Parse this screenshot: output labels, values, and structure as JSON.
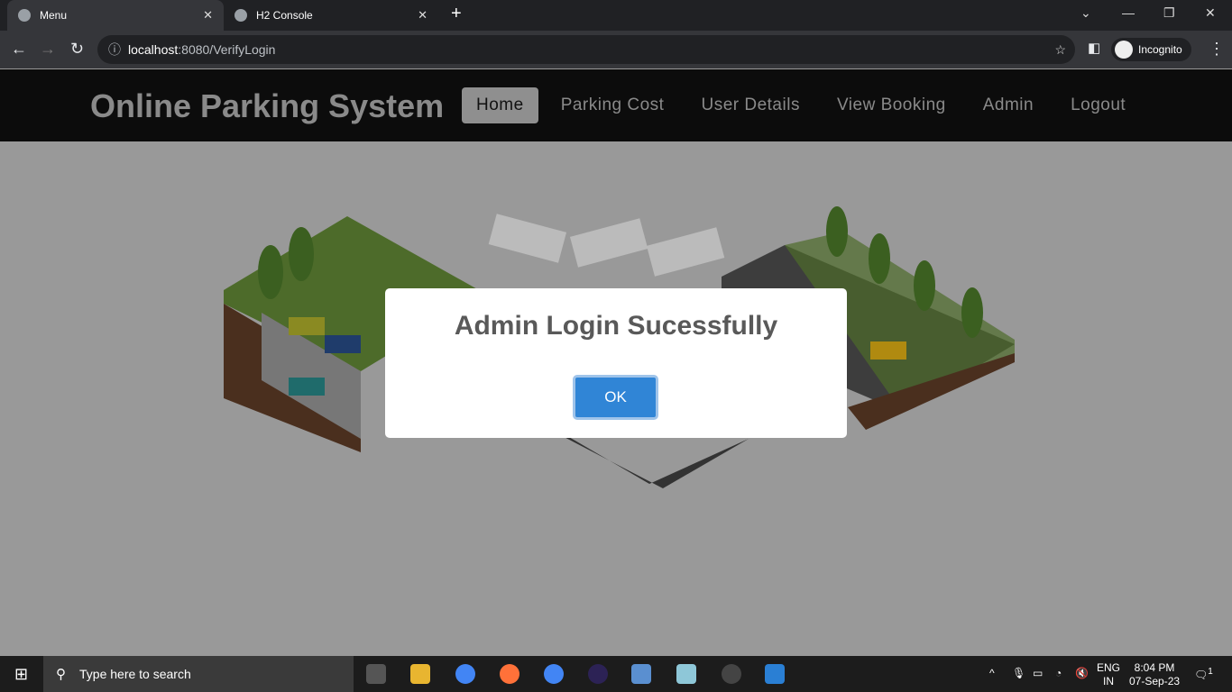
{
  "browser": {
    "tabs": [
      {
        "label": "Menu",
        "active": true
      },
      {
        "label": "H2 Console",
        "active": false
      }
    ],
    "url_host": "localhost",
    "url_rest": ":8080/VerifyLogin",
    "profile": "Incognito"
  },
  "site": {
    "brand": "Online Parking System",
    "menu": [
      "Home",
      "Parking Cost",
      "User Details",
      "View Booking",
      "Admin",
      "Logout"
    ]
  },
  "dialog": {
    "title": "Admin Login Sucessfully",
    "ok": "OK"
  },
  "taskbar": {
    "search_placeholder": "Type here to search",
    "lang": "ENG",
    "region": "IN",
    "time": "8:04 PM",
    "date": "07-Sep-23",
    "notifications": "1"
  },
  "colors": {
    "ok_button": "#3085d6",
    "nav_bg": "#0c0c0c",
    "overlay": "#999999"
  }
}
